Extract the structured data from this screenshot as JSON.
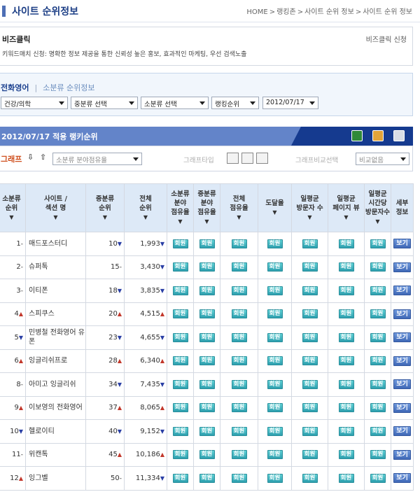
{
  "header": {
    "title": "사이트 순위정보",
    "breadcrumb": [
      "HOME",
      ">",
      "랭킹존",
      ">",
      "사이트 순위 정보",
      ">",
      "사이트 순위 정보"
    ]
  },
  "bizclick": {
    "title": "비즈클릭",
    "apply_link": "비즈클릭 신청",
    "desc": "키워드매치 신청: 명확한 정보 제공을 통한 신뢰성 높은 홍보, 효과적인 마케팅, 우선 검색노출"
  },
  "filters": {
    "tab_active": "전화영어",
    "tab_sep": "|",
    "tab_inactive": "소분류 순위정보",
    "selects": [
      "건강/의학",
      "중분류 선택",
      "소분류 선택",
      "랭킹순위",
      "2012/07/17"
    ]
  },
  "ranking": {
    "title": "2012/07/17 적용 랭키순위",
    "graph_label": "그래프",
    "graph_select": "소분류 분야점유율",
    "graph_type_label": "그래프타입",
    "compare_label": "그래프비교선택",
    "compare_select": "비교없음"
  },
  "table": {
    "headers": [
      {
        "lines": [
          "소분류",
          "순위"
        ],
        "arrow": "▼"
      },
      {
        "lines": [
          "사이트 /",
          "섹션 명"
        ],
        "arrow": "▼"
      },
      {
        "lines": [
          "중분류",
          "순위"
        ],
        "arrow": "▼"
      },
      {
        "lines": [
          "전체",
          "순위"
        ],
        "arrow": "▼"
      },
      {
        "lines": [
          "소분류",
          "분야",
          "점유율"
        ],
        "arrow": "▼"
      },
      {
        "lines": [
          "중분류",
          "분야",
          "점유율"
        ],
        "arrow": "▼"
      },
      {
        "lines": [
          "전체",
          "점유율"
        ],
        "arrow": "▼"
      },
      {
        "lines": [
          "도달율"
        ],
        "arrow": "▼"
      },
      {
        "lines": [
          "일평균",
          "방문자 수"
        ],
        "arrow": "▼"
      },
      {
        "lines": [
          "일평균",
          "페이지 뷰"
        ],
        "arrow": "▼"
      },
      {
        "lines": [
          "일평균",
          "시간당",
          "방문자수"
        ],
        "arrow": "▼"
      },
      {
        "lines": [
          "세부",
          "정보"
        ],
        "arrow": ""
      }
    ],
    "member_label": "회원",
    "view_label": "보기",
    "rows": [
      {
        "rank": "1",
        "rank_mark": "-",
        "name": "매드포스터디",
        "mid": "10",
        "mid_mark": "▼",
        "total": "1,993",
        "total_mark": "▼"
      },
      {
        "rank": "2",
        "rank_mark": "-",
        "name": "슈퍼톡",
        "mid": "15",
        "mid_mark": "-",
        "total": "3,430",
        "total_mark": "▼"
      },
      {
        "rank": "3",
        "rank_mark": "-",
        "name": "이티폰",
        "mid": "18",
        "mid_mark": "▼",
        "total": "3,835",
        "total_mark": "▼"
      },
      {
        "rank": "4",
        "rank_mark": "▲",
        "name": "스피쿠스",
        "mid": "20",
        "mid_mark": "▲",
        "total": "4,515",
        "total_mark": "▲"
      },
      {
        "rank": "5",
        "rank_mark": "▼",
        "name": "민병철 전화영어 유폰",
        "mid": "23",
        "mid_mark": "▼",
        "total": "4,655",
        "total_mark": "▼"
      },
      {
        "rank": "6",
        "rank_mark": "▲",
        "name": "잉글리쉬프로",
        "mid": "28",
        "mid_mark": "▲",
        "total": "6,340",
        "total_mark": "▲"
      },
      {
        "rank": "8",
        "rank_mark": "-",
        "name": "아미고 잉글리쉬",
        "mid": "34",
        "mid_mark": "▼",
        "total": "7,435",
        "total_mark": "▼"
      },
      {
        "rank": "9",
        "rank_mark": "▲",
        "name": "이보영의 전화영어",
        "mid": "37",
        "mid_mark": "▲",
        "total": "8,065",
        "total_mark": "▲"
      },
      {
        "rank": "10",
        "rank_mark": "▼",
        "name": "헬로이티",
        "mid": "40",
        "mid_mark": "▼",
        "total": "9,152",
        "total_mark": "▼"
      },
      {
        "rank": "11",
        "rank_mark": "-",
        "name": "위캔톡",
        "mid": "45",
        "mid_mark": "▲",
        "total": "10,186",
        "total_mark": "▲"
      },
      {
        "rank": "12",
        "rank_mark": "▲",
        "name": "잉그벨",
        "mid": "50",
        "mid_mark": "-",
        "total": "11,334",
        "total_mark": "▼"
      }
    ]
  },
  "colors": {
    "accent": "#1d3f86",
    "rank_up": "#c2372b",
    "rank_down": "#2a3fa5",
    "member_badge": "#2d9fae",
    "view_button": "#3f68b6"
  }
}
